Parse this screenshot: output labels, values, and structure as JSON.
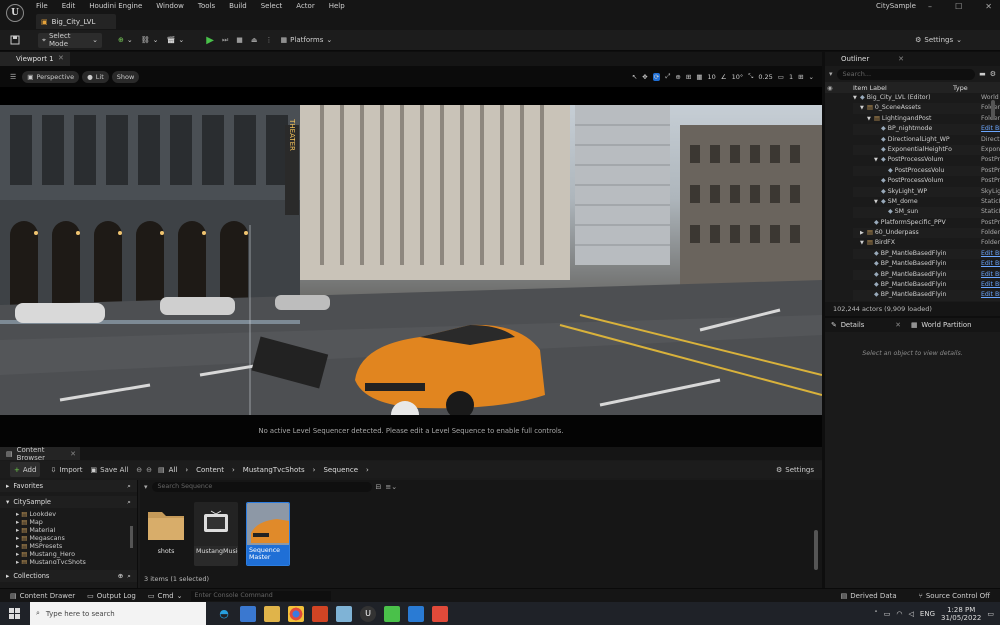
{
  "menubar": {
    "logo": "U",
    "items": [
      "File",
      "Edit",
      "Houdini Engine",
      "Window",
      "Tools",
      "Build",
      "Select",
      "Actor",
      "Help"
    ],
    "project": "CitySample",
    "level_tab": "Big_City_LVL",
    "controls": [
      "–",
      "☐",
      "✕"
    ]
  },
  "toolbar": {
    "select_mode": "Select Mode",
    "platforms": "Platforms",
    "settings": "Settings"
  },
  "viewport": {
    "tab": "Viewport 1",
    "perspective": "Perspective",
    "lit": "Lit",
    "show": "Show",
    "grid_snap": "10",
    "rot_snap": "10°",
    "scale_snap": "0.25",
    "camera_speed": "1",
    "message": "No active Level Sequencer detected. Please edit a Level Sequence to enable full controls.",
    "sign_text": "THEATER"
  },
  "outliner": {
    "title": "Outliner",
    "search_placeholder": "Search...",
    "col_label": "Item Label",
    "col_type": "Type",
    "rows": [
      {
        "label": "Big_City_LVL (Editor)",
        "type": "World",
        "indent": 0,
        "arrow": "▼",
        "link": false
      },
      {
        "label": "0_SceneAssets",
        "type": "Folder",
        "indent": 1,
        "arrow": "▼",
        "link": false
      },
      {
        "label": "LightingandPost",
        "type": "Folder",
        "indent": 2,
        "arrow": "▼",
        "link": false
      },
      {
        "label": "BP_nightmode",
        "type": "Edit BP_night",
        "indent": 3,
        "arrow": "",
        "link": true
      },
      {
        "label": "DirectionalLight_WP",
        "type": "DirectionalL",
        "indent": 3,
        "arrow": "",
        "link": false
      },
      {
        "label": "ExponentialHeightFo",
        "type": "Exponential",
        "indent": 3,
        "arrow": "",
        "link": false
      },
      {
        "label": "PostProcessVolum",
        "type": "PostProcess",
        "indent": 3,
        "arrow": "▼",
        "link": false
      },
      {
        "label": "PostProcessVolu",
        "type": "PostProcess",
        "indent": 4,
        "arrow": "",
        "link": false
      },
      {
        "label": "PostProcessVolum",
        "type": "PostProcess",
        "indent": 3,
        "arrow": "",
        "link": false
      },
      {
        "label": "SkyLight_WP",
        "type": "SkyLight",
        "indent": 3,
        "arrow": "",
        "link": false
      },
      {
        "label": "SM_dome",
        "type": "StaticMesh",
        "indent": 3,
        "arrow": "▼",
        "link": false
      },
      {
        "label": "SM_sun",
        "type": "StaticMesh",
        "indent": 4,
        "arrow": "",
        "link": false
      },
      {
        "label": "PlatformSpecific_PPV",
        "type": "PostProcess",
        "indent": 2,
        "arrow": "",
        "link": false
      },
      {
        "label": "60_Underpass",
        "type": "Folder",
        "indent": 1,
        "arrow": "▶",
        "link": false
      },
      {
        "label": "BirdFX",
        "type": "Folder",
        "indent": 1,
        "arrow": "▼",
        "link": false
      },
      {
        "label": "BP_MantleBasedFlyin",
        "type": "Edit BP_Man",
        "indent": 2,
        "arrow": "",
        "link": true
      },
      {
        "label": "BP_MantleBasedFlyin",
        "type": "Edit BP_Man",
        "indent": 2,
        "arrow": "",
        "link": true
      },
      {
        "label": "BP_MantleBasedFlyin",
        "type": "Edit BP_Man",
        "indent": 2,
        "arrow": "",
        "link": true
      },
      {
        "label": "BP_MantleBasedFlyin",
        "type": "Edit BP_Man",
        "indent": 2,
        "arrow": "",
        "link": true
      },
      {
        "label": "BP_MantleBasedFlyin",
        "type": "Edit BP_Man",
        "indent": 2,
        "arrow": "",
        "link": true
      }
    ],
    "actor_count": "102,244 actors (9,909 loaded)"
  },
  "details": {
    "tab1": "Details",
    "tab2": "World Partition",
    "empty": "Select an object to view details."
  },
  "content_browser": {
    "tab": "Content Browser",
    "add": "Add",
    "import": "Import",
    "save_all": "Save All",
    "settings": "Settings",
    "path": [
      "All",
      "Content",
      "MustangTvcShots",
      "Sequence"
    ],
    "favorites": "Favorites",
    "root": "CitySample",
    "folders": [
      "Lookdev",
      "Map",
      "Material",
      "Megascans",
      "MSPresets",
      "Mustang_Hero",
      "MustangTvcShots"
    ],
    "collections": "Collections",
    "search_placeholder": "Search Sequence",
    "assets": [
      {
        "name": "shots",
        "kind": "folder"
      },
      {
        "name": "MustangMusic",
        "kind": "media"
      },
      {
        "name": "Sequence Master",
        "kind": "sequence"
      }
    ],
    "count": "3 items (1 selected)"
  },
  "statusbar": {
    "content_drawer": "Content Drawer",
    "output_log": "Output Log",
    "cmd": "Cmd",
    "console_placeholder": "Enter Console Command",
    "derived_data": "Derived Data",
    "source_control": "Source Control Off"
  },
  "taskbar": {
    "search_placeholder": "Type here to search",
    "lang": "ENG",
    "time": "1:28 PM",
    "date": "31/05/2022"
  }
}
